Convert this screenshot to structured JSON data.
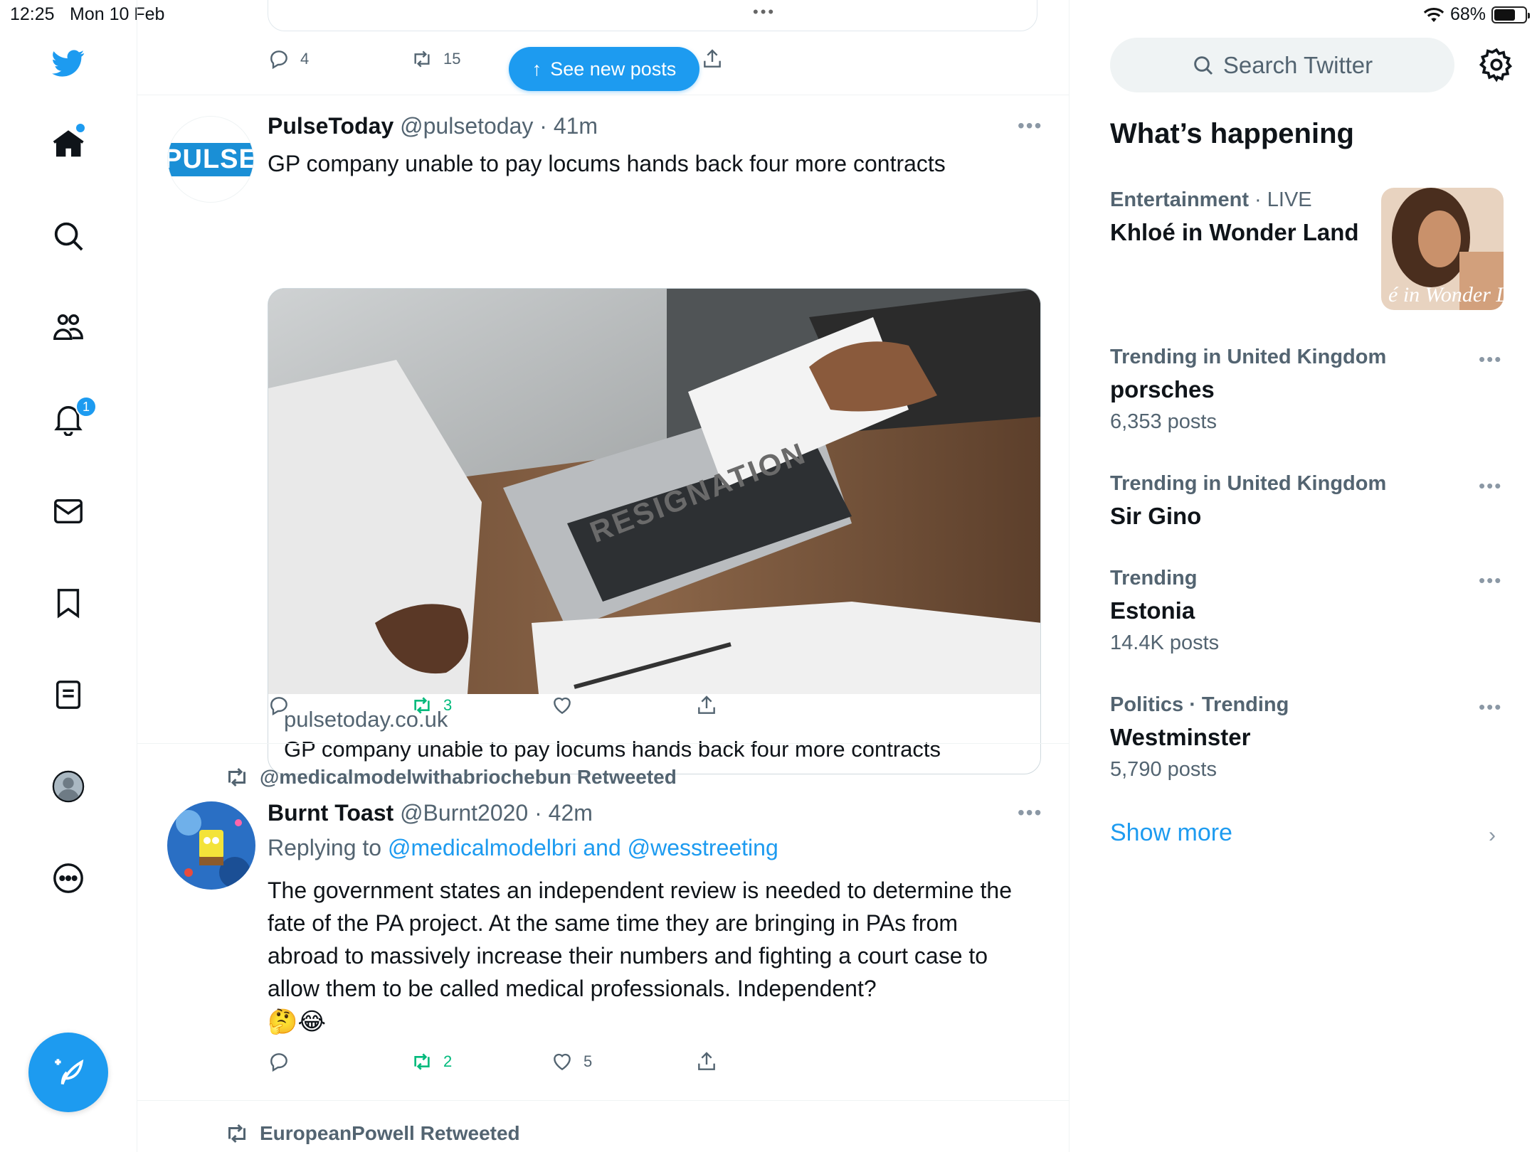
{
  "status_bar": {
    "time": "12:25",
    "date": "Mon 10 Feb",
    "battery": "68%",
    "battery_level": 0.68
  },
  "nav": {
    "items": [
      "twitter-logo",
      "home",
      "search",
      "communities",
      "notifications",
      "messages",
      "bookmarks",
      "lists",
      "profile",
      "more"
    ],
    "notification_count": "1"
  },
  "timeline": {
    "new_posts_label": "See new posts",
    "prev_tweet": {
      "replies": "4",
      "retweets": "15"
    },
    "tweets": [
      {
        "name": "PulseToday",
        "handle": "@pulsetoday",
        "sep": "·",
        "time": "41m",
        "avatar_text": "PULSE",
        "text": "GP company unable to pay locums hands back four more contracts",
        "image_text": "RESIGNATION",
        "link_domain": "pulsetoday.co.uk",
        "link_title": "GP company unable to pay locums hands back four more contracts",
        "replies": "",
        "retweets": "3",
        "likes": ""
      },
      {
        "retweeted_by": "@medicalmodelwithabriochebun Retweeted",
        "name": "Burnt Toast",
        "handle": "@Burnt2020",
        "sep": "·",
        "time": "42m",
        "replying_prefix": "Replying to",
        "replying_mentions": "@medicalmodelbri and @wesstreeting",
        "text": "The government states an independent review is needed to determine the fate of the PA project. At the same time they are bringing in PAs from abroad to massively increase their numbers and fighting a court case to allow them to be called medical professionals. Independent?",
        "emojis": "🤔😂",
        "replies": "",
        "retweets": "2",
        "likes": "5"
      }
    ],
    "next_retweeted_by": "EuropeanPowell Retweeted"
  },
  "sidebar": {
    "search_placeholder": "Search Twitter",
    "section_title": "What’s happening",
    "trends": [
      {
        "context": "Entertainment",
        "live": " · LIVE",
        "topic": "Khloé in Wonder Land",
        "count": "",
        "thumb_text": "é in Wonder L"
      },
      {
        "context": "Trending in United Kingdom",
        "topic": "porsches",
        "count": "6,353 posts"
      },
      {
        "context": "Trending in United Kingdom",
        "topic": "Sir Gino",
        "count": ""
      },
      {
        "context": "Trending",
        "topic": "Estonia",
        "count": "14.4K posts"
      },
      {
        "context": "Politics · Trending",
        "topic": "Westminster",
        "count": "5,790 posts"
      }
    ],
    "show_more": "Show more"
  },
  "colors": {
    "accent": "#1d9bf0",
    "retweet_green": "#00ba7c",
    "secondary_text": "#536471"
  }
}
